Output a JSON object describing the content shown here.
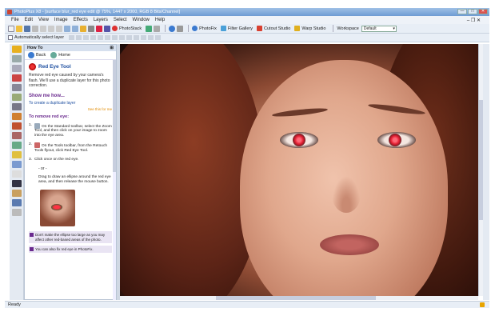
{
  "window": {
    "title": "PhotoPlus X8 - [surface blur_red eye edit @ 75%, 1447 x 2000, RGB 8 Bits/Channel]",
    "controls": [
      "—",
      "□",
      "✕"
    ]
  },
  "menu": {
    "items": [
      "File",
      "Edit",
      "View",
      "Image",
      "Effects",
      "Layers",
      "Select",
      "Window",
      "Help"
    ],
    "mdi": "– ❐ ✕"
  },
  "toolbar": {
    "photostack": "PhotoStack",
    "photofix": "PhotoFix",
    "filter_gallery": "Filter Gallery",
    "cutout_studio": "Cutout Studio",
    "warp_studio": "Warp Studio",
    "workspace_label": "Workspace",
    "workspace_value": "Default"
  },
  "context_bar": {
    "auto_select_label": "Automatically select layer"
  },
  "howto": {
    "panel_title": "How To",
    "back": "Back",
    "home": "Home",
    "title": "Red Eye Tool",
    "description": "Remove red eye caused by your camera's flash. We'll use a duplicate layer for this photo correction.",
    "show_me": "Show me how...",
    "duplicate_link": "To create a duplicate layer",
    "see_this": "See this for me",
    "to_remove": "To remove red eye:",
    "step1_num": "1.",
    "step1": "On the Standard toolbar, select the Zoom Tool, and then click on your image to zoom into the eye area.",
    "step2_num": "2.",
    "step2": "On the Tools toolbar, from the Retouch Tools flyout, click Red Eye Tool.",
    "step3_num": "3.",
    "step3": "Click once on the red eye.",
    "or": "- or -",
    "drag": "Drag to draw an ellipse around the red eye area, and then release the mouse button.",
    "note1": "Don't make the ellipse too large as you may affect other red-based areas of the photo.",
    "note2": "You can also fix red eye in PhotoFix."
  },
  "status": {
    "text": "Ready"
  },
  "colors": {
    "accent": "#1e4fa0",
    "howto_heading": "#6a2a8e",
    "link_orange": "#e08a00"
  }
}
